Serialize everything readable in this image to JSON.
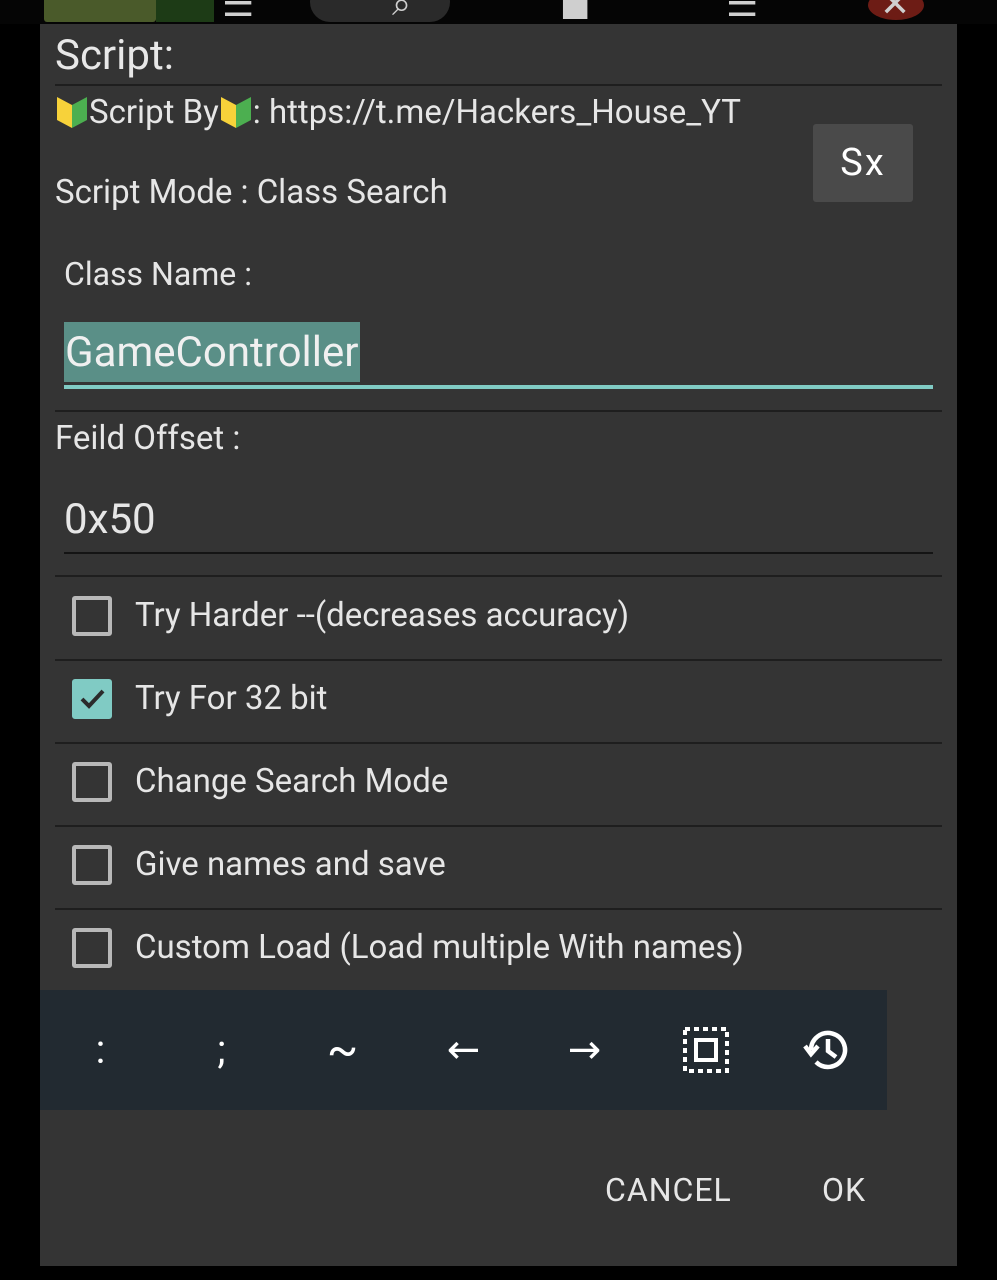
{
  "dialog": {
    "title": "Script:",
    "credit_prefix": "Script By",
    "credit_suffix": ": https://t.me/Hackers_House_YT",
    "mode_text": "Script Mode : Class Search",
    "sx_button": "Sx",
    "class_name_label": "Class Name :",
    "class_name_value": "GameController",
    "field_offset_label": "Feild Offset :",
    "field_offset_value": "0x50",
    "checkboxes": [
      {
        "label": "Try Harder --(decreases accuracy)",
        "checked": false
      },
      {
        "label": "Try For 32 bit",
        "checked": true
      },
      {
        "label": "Change Search Mode",
        "checked": false
      },
      {
        "label": "Give names and save",
        "checked": false
      },
      {
        "label": "Custom Load (Load multiple With names)",
        "checked": false
      }
    ],
    "keybar": {
      "keys": [
        ":",
        ";",
        "~",
        "←",
        "→"
      ],
      "icons": [
        "select-all-icon",
        "history-icon"
      ]
    },
    "buttons": {
      "cancel": "CANCEL",
      "ok": "OK"
    }
  },
  "colors": {
    "dialog_bg": "#343434",
    "accent": "#80cbc4",
    "keybar_bg": "#222a31",
    "text": "#e6e6e6"
  }
}
